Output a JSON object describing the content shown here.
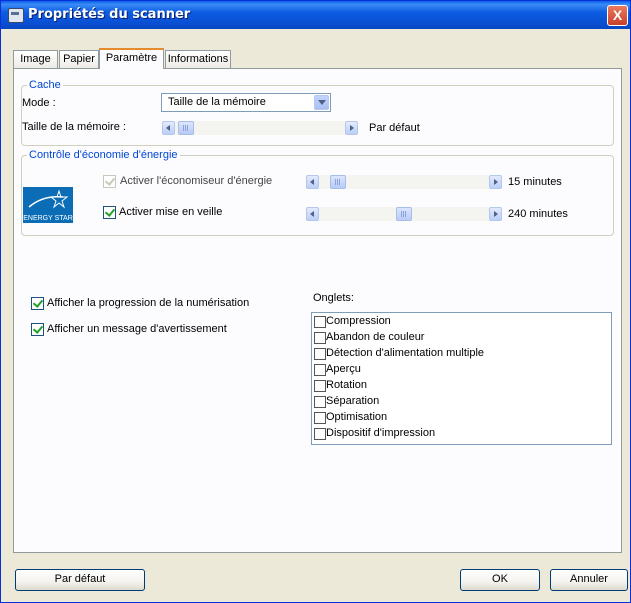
{
  "window": {
    "title": "Propriétés du scanner",
    "close_label": "X"
  },
  "tabs": [
    {
      "label": "Image"
    },
    {
      "label": "Papier"
    },
    {
      "label": "Paramètre"
    },
    {
      "label": "Informations"
    }
  ],
  "cache": {
    "legend": "Cache",
    "mode_label": "Mode :",
    "mode_value": "Taille de la mémoire",
    "memory_label": "Taille de la mémoire :",
    "memory_value": "Par défaut",
    "memory_level_fraction": 0
  },
  "energy": {
    "legend": "Contrôle d'économie d'énergie",
    "logo_text": "ENERGY STAR",
    "saver_label": "Activer l'économiseur d'énergie",
    "saver_checked": true,
    "saver_disabled": true,
    "saver_value": "15 minutes",
    "saver_level_fraction": 0.05,
    "sleep_label": "Activer mise en veille",
    "sleep_checked": true,
    "sleep_value": "240 minutes",
    "sleep_level_fraction": 0.5
  },
  "options": {
    "progress_label": "Afficher la progression de la numérisation",
    "progress_checked": true,
    "warning_label": "Afficher un message d'avertissement",
    "warning_checked": true
  },
  "onglets": {
    "label": "Onglets:",
    "items": [
      {
        "label": "Compression",
        "checked": false
      },
      {
        "label": "Abandon de couleur",
        "checked": false
      },
      {
        "label": "Détection d'alimentation multiple",
        "checked": false
      },
      {
        "label": "Aperçu",
        "checked": false
      },
      {
        "label": "Rotation",
        "checked": false
      },
      {
        "label": "Séparation",
        "checked": false
      },
      {
        "label": "Optimisation",
        "checked": false
      },
      {
        "label": "Dispositif d'impression",
        "checked": false
      }
    ]
  },
  "buttons": {
    "default_label": "Par défaut",
    "ok_label": "OK",
    "cancel_label": "Annuler"
  },
  "colors": {
    "title_bar": "#0a5ee8",
    "group_legend": "#0046d5",
    "active_tab_accent": "#e68b2c",
    "energy_star": "#0a6db6"
  }
}
